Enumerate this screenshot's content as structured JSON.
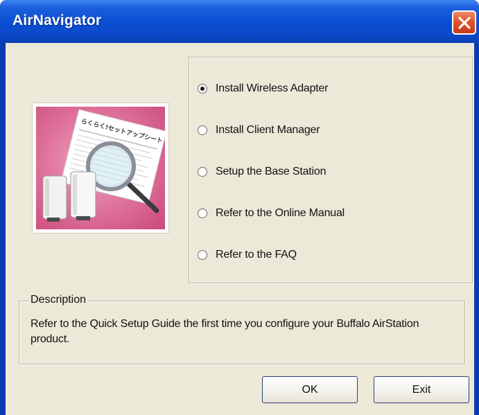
{
  "window": {
    "title": "AirNavigator"
  },
  "illustration": {
    "caption": "らくらく!セットアップシート"
  },
  "options": {
    "selected_index": 0,
    "items": [
      {
        "label": "Install Wireless Adapter",
        "selected": true
      },
      {
        "label": "Install Client Manager",
        "selected": false
      },
      {
        "label": "Setup the Base Station",
        "selected": false
      },
      {
        "label": "Refer to the Online Manual",
        "selected": false
      },
      {
        "label": "Refer to the FAQ",
        "selected": false
      }
    ]
  },
  "description": {
    "legend": "Description",
    "text": "Refer to the Quick Setup Guide the first time you configure your Buffalo AirStation product."
  },
  "buttons": {
    "ok_label": "OK",
    "exit_label": "Exit"
  },
  "colors": {
    "titlebar": "#0c4fd3",
    "close_button": "#e2542b",
    "dialog_background": "#ece9d8",
    "illustration_background": "#dd6e98"
  }
}
